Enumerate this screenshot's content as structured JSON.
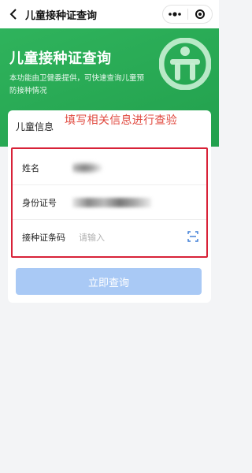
{
  "navbar": {
    "back_icon": "chevron-left-icon",
    "title": "儿童接种证查询",
    "more_icon": "more-dots-icon",
    "close_icon": "target-icon"
  },
  "hero": {
    "title": "儿童接种证查询",
    "description": "本功能由卫健委提供，可快速查询儿童预防接种情况",
    "background_color": "#27a853",
    "logo_icon": "health-logo-icon"
  },
  "card": {
    "title": "儿童信息",
    "annotation": "填写相关信息进行查验",
    "annotation_color": "#e0483e",
    "highlight_color": "#d82238",
    "fields": [
      {
        "label": "姓名"
      },
      {
        "label": "身份证号"
      },
      {
        "label": "接种证条码",
        "placeholder": "请输入",
        "icon": "scan-icon"
      }
    ],
    "submit_label": "立即查询",
    "submit_color": "#a9c9f5"
  }
}
